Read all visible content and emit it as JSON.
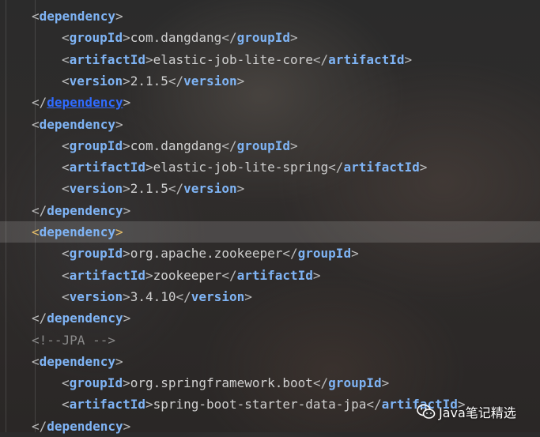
{
  "lines": [
    {
      "indent": 1,
      "type": "open",
      "tag": "dependency"
    },
    {
      "indent": 2,
      "type": "element",
      "tag": "groupId",
      "value": "com.dangdang"
    },
    {
      "indent": 2,
      "type": "element",
      "tag": "artifactId",
      "value": "elastic-job-lite-core"
    },
    {
      "indent": 2,
      "type": "element",
      "tag": "version",
      "value": "2.1.5"
    },
    {
      "indent": 1,
      "type": "close",
      "tag": "dependency",
      "link": true
    },
    {
      "indent": 1,
      "type": "open",
      "tag": "dependency"
    },
    {
      "indent": 2,
      "type": "element",
      "tag": "groupId",
      "value": "com.dangdang"
    },
    {
      "indent": 2,
      "type": "element",
      "tag": "artifactId",
      "value": "elastic-job-lite-spring"
    },
    {
      "indent": 2,
      "type": "element",
      "tag": "version",
      "value": "2.1.5"
    },
    {
      "indent": 1,
      "type": "close",
      "tag": "dependency"
    },
    {
      "indent": 1,
      "type": "open",
      "tag": "dependency",
      "current": true
    },
    {
      "indent": 2,
      "type": "element",
      "tag": "groupId",
      "value": "org.apache.zookeeper"
    },
    {
      "indent": 2,
      "type": "element",
      "tag": "artifactId",
      "value": "zookeeper"
    },
    {
      "indent": 2,
      "type": "element",
      "tag": "version",
      "value": "3.4.10"
    },
    {
      "indent": 1,
      "type": "close",
      "tag": "dependency"
    },
    {
      "indent": 1,
      "type": "comment",
      "value": "<!--JPA -->"
    },
    {
      "indent": 1,
      "type": "open",
      "tag": "dependency"
    },
    {
      "indent": 2,
      "type": "element",
      "tag": "groupId",
      "value": "org.springframework.boot"
    },
    {
      "indent": 2,
      "type": "element",
      "tag": "artifactId",
      "value": "spring-boot-starter-data-jpa"
    },
    {
      "indent": 1,
      "type": "close",
      "tag": "dependency"
    }
  ],
  "watermark": {
    "text": "Java笔记精选",
    "icon": "wechat-icon"
  },
  "colors": {
    "tag": "#7fb4f5",
    "bracket": "#bcbcbc",
    "match_bracket": "#e8bf6a",
    "text": "#d0d0d0",
    "comment": "#8a8a8a",
    "link": "#2f6bff",
    "current_line": "rgba(255,255,255,0.14)"
  }
}
